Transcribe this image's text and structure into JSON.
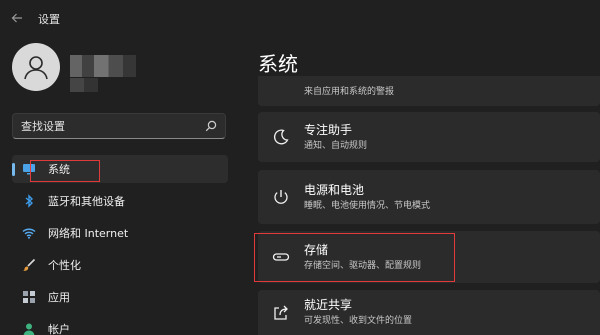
{
  "window": {
    "title": "设置"
  },
  "search": {
    "placeholder": "查找设置"
  },
  "sidebar": {
    "items": [
      {
        "label": "系统"
      },
      {
        "label": "蓝牙和其他设备"
      },
      {
        "label": "网络和 Internet"
      },
      {
        "label": "个性化"
      },
      {
        "label": "应用"
      },
      {
        "label": "帐户"
      }
    ]
  },
  "main": {
    "title": "系统",
    "notifications": {
      "subtitle": "来自应用和系统的警报"
    },
    "cards": [
      {
        "title": "专注助手",
        "subtitle": "通知、自动规则"
      },
      {
        "title": "电源和电池",
        "subtitle": "睡眠、电池使用情况、节电模式"
      },
      {
        "title": "存储",
        "subtitle": "存储空间、驱动器、配置规则"
      },
      {
        "title": "就近共享",
        "subtitle": "可发现性、收到文件的位置"
      }
    ]
  },
  "colors": {
    "accent": "#76b9ed",
    "highlight": "#e03a3a",
    "background": "#202020",
    "card": "#2b2b2b"
  }
}
